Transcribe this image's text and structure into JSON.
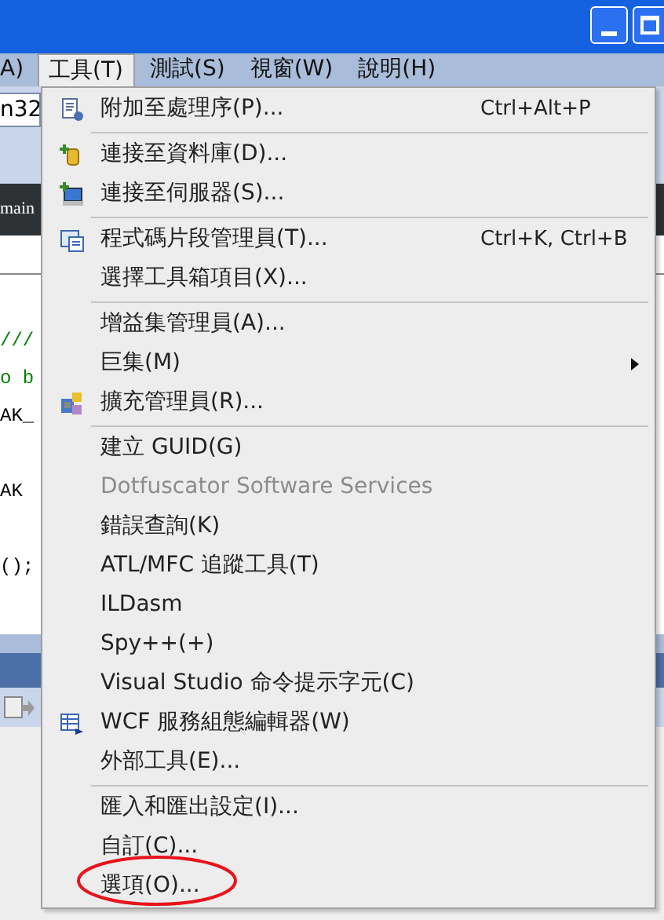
{
  "menu_bar": [
    {
      "label": "A)",
      "selected": false
    },
    {
      "label": "工具(T)",
      "selected": true
    },
    {
      "label": "測試(S)",
      "selected": false
    },
    {
      "label": "視窗(W)",
      "selected": false
    },
    {
      "label": "說明(H)",
      "selected": false
    }
  ],
  "background": {
    "combo_value": "n32",
    "tab_label": "main",
    "code_lines": [
      {
        "text": "///",
        "kind": "comment"
      },
      {
        "text": "o b",
        "kind": "comment"
      },
      {
        "text": "AK_",
        "kind": "code"
      },
      {
        "kind": "blank"
      },
      {
        "text": "AK",
        "kind": "code"
      },
      {
        "kind": "blank"
      },
      {
        "text": "();",
        "kind": "code"
      }
    ]
  },
  "menu": [
    {
      "kind": "item",
      "label": "附加至處理序(P)...",
      "shortcut": "Ctrl+Alt+P",
      "disabled": false
    },
    {
      "kind": "separator"
    },
    {
      "kind": "item",
      "label": "連接至資料庫(D)...",
      "disabled": false
    },
    {
      "kind": "item",
      "label": "連接至伺服器(S)...",
      "disabled": false
    },
    {
      "kind": "separator"
    },
    {
      "kind": "item",
      "label": "程式碼片段管理員(T)...",
      "shortcut": "Ctrl+K, Ctrl+B",
      "disabled": false
    },
    {
      "kind": "item",
      "label": "選擇工具箱項目(X)...",
      "disabled": false
    },
    {
      "kind": "separator"
    },
    {
      "kind": "item",
      "label": "增益集管理員(A)...",
      "disabled": false
    },
    {
      "kind": "item",
      "label": "巨集(M)",
      "disabled": false,
      "submenu": true
    },
    {
      "kind": "item",
      "label": "擴充管理員(R)...",
      "disabled": false
    },
    {
      "kind": "separator"
    },
    {
      "kind": "item",
      "label": "建立 GUID(G)",
      "disabled": false
    },
    {
      "kind": "item",
      "label": "Dotfuscator Software Services",
      "disabled": true
    },
    {
      "kind": "item",
      "label": "錯誤查詢(K)",
      "disabled": false
    },
    {
      "kind": "item",
      "label": "ATL/MFC 追蹤工具(T)",
      "disabled": false
    },
    {
      "kind": "item",
      "label": "ILDasm",
      "disabled": false
    },
    {
      "kind": "item",
      "label": "Spy++(+)",
      "disabled": false
    },
    {
      "kind": "item",
      "label": "Visual Studio 命令提示字元(C)",
      "disabled": false
    },
    {
      "kind": "item",
      "label": "WCF 服務組態編輯器(W)",
      "disabled": false
    },
    {
      "kind": "item",
      "label": "外部工具(E)...",
      "disabled": false
    },
    {
      "kind": "separator"
    },
    {
      "kind": "item",
      "label": "匯入和匯出設定(I)...",
      "disabled": false
    },
    {
      "kind": "item",
      "label": "自訂(C)...",
      "disabled": false
    },
    {
      "kind": "item",
      "label": "選項(O)...",
      "disabled": false,
      "circled": true
    }
  ]
}
